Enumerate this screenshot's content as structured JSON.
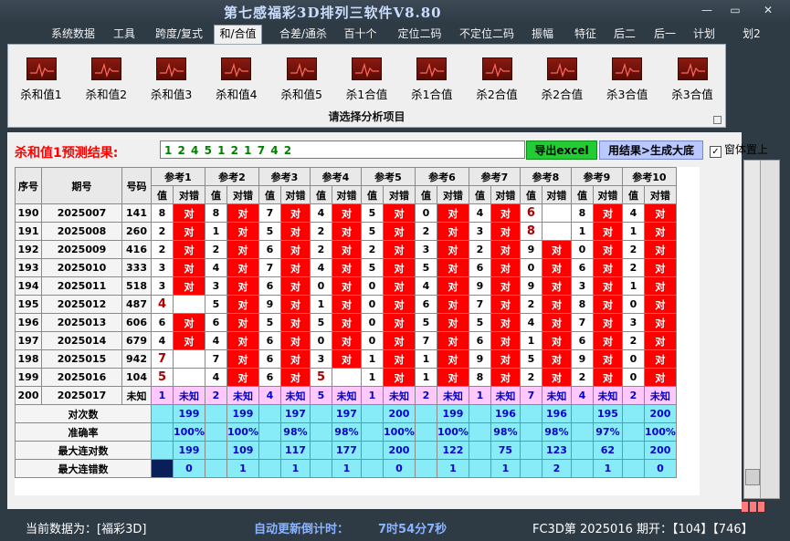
{
  "app": {
    "title": "第七感福彩3D排列三软件V8.80"
  },
  "window_buttons": {
    "minimize": "—",
    "restore": "▭",
    "close": "✕"
  },
  "menu": {
    "items": [
      "系统数据",
      "工具",
      "跨度/复式",
      "和/合值",
      "合差/通杀",
      "百十个",
      "定位二码",
      "不定位二码",
      "振幅",
      "特征",
      "后二",
      "后一",
      "计划",
      "划2"
    ],
    "active_index": 3
  },
  "ribbon": {
    "buttons": [
      "杀和值1",
      "杀和值2",
      "杀和值3",
      "杀和值4",
      "杀和值5",
      "杀1合值",
      "杀1合值",
      "杀2合值",
      "杀2合值",
      "杀3合值",
      "杀3合值"
    ],
    "caption": "请选择分析项目",
    "icon": "line-chart-icon"
  },
  "prediction": {
    "label": "杀和值1预测结果:",
    "value": "1 2 4 5 1 2 1 7 4 2",
    "export_button": "导出excel",
    "generate_button": "用结果>生成大底",
    "topmost_label": "窗体置上",
    "topmost_checked": "✓"
  },
  "table": {
    "headers": {
      "seq": "序号",
      "period": "期号",
      "number": "号码",
      "value": "值",
      "result": "对错"
    },
    "groups": [
      "参考1",
      "参考2",
      "参考3",
      "参考4",
      "参考5",
      "参考6",
      "参考7",
      "参考8",
      "参考9",
      "参考10"
    ],
    "hit_text": "对",
    "rows": [
      {
        "seq": "190",
        "period": "2025007",
        "number": "141",
        "values": [
          "8",
          "8",
          "7",
          "4",
          "5",
          "0",
          "4",
          "6",
          "8",
          "4"
        ],
        "hits": [
          1,
          1,
          1,
          1,
          1,
          1,
          1,
          0,
          1,
          1
        ]
      },
      {
        "seq": "191",
        "period": "2025008",
        "number": "260",
        "values": [
          "2",
          "1",
          "5",
          "2",
          "5",
          "2",
          "3",
          "8",
          "1",
          "1"
        ],
        "hits": [
          1,
          1,
          1,
          1,
          1,
          1,
          1,
          0,
          1,
          1
        ]
      },
      {
        "seq": "192",
        "period": "2025009",
        "number": "416",
        "values": [
          "2",
          "2",
          "6",
          "2",
          "2",
          "3",
          "2",
          "9",
          "0",
          "2"
        ],
        "hits": [
          1,
          1,
          1,
          1,
          1,
          1,
          1,
          1,
          1,
          1
        ]
      },
      {
        "seq": "193",
        "period": "2025010",
        "number": "333",
        "values": [
          "3",
          "4",
          "7",
          "4",
          "5",
          "5",
          "6",
          "0",
          "6",
          "2"
        ],
        "hits": [
          1,
          1,
          1,
          1,
          1,
          1,
          1,
          1,
          1,
          1
        ]
      },
      {
        "seq": "194",
        "period": "2025011",
        "number": "518",
        "values": [
          "3",
          "3",
          "6",
          "0",
          "0",
          "4",
          "9",
          "9",
          "3",
          "1"
        ],
        "hits": [
          1,
          1,
          1,
          1,
          1,
          1,
          1,
          1,
          1,
          1
        ]
      },
      {
        "seq": "195",
        "period": "2025012",
        "number": "487",
        "values": [
          "4",
          "5",
          "9",
          "1",
          "0",
          "6",
          "7",
          "2",
          "8",
          "0"
        ],
        "hits": [
          0,
          1,
          1,
          1,
          1,
          1,
          1,
          1,
          1,
          1
        ]
      },
      {
        "seq": "196",
        "period": "2025013",
        "number": "606",
        "values": [
          "6",
          "6",
          "5",
          "5",
          "0",
          "5",
          "5",
          "4",
          "7",
          "3"
        ],
        "hits": [
          1,
          1,
          1,
          1,
          1,
          1,
          1,
          1,
          1,
          1
        ]
      },
      {
        "seq": "197",
        "period": "2025014",
        "number": "679",
        "values": [
          "4",
          "4",
          "6",
          "0",
          "0",
          "7",
          "6",
          "1",
          "6",
          "2"
        ],
        "hits": [
          1,
          1,
          1,
          1,
          1,
          1,
          1,
          1,
          1,
          1
        ]
      },
      {
        "seq": "198",
        "period": "2025015",
        "number": "942",
        "values": [
          "7",
          "7",
          "6",
          "3",
          "1",
          "1",
          "9",
          "5",
          "9",
          "0"
        ],
        "hits": [
          0,
          1,
          1,
          1,
          1,
          1,
          1,
          1,
          1,
          1
        ]
      },
      {
        "seq": "199",
        "period": "2025016",
        "number": "104",
        "values": [
          "5",
          "4",
          "6",
          "5",
          "1",
          "1",
          "8",
          "2",
          "2",
          "0"
        ],
        "hits": [
          0,
          1,
          1,
          0,
          1,
          1,
          1,
          1,
          1,
          1
        ]
      }
    ],
    "missed_values": [
      [
        7
      ],
      [
        7
      ],
      [],
      [],
      [],
      [],
      [],
      [],
      [
        0
      ],
      [
        0,
        3
      ]
    ],
    "prediction_row": {
      "seq": "200",
      "period": "2025017",
      "number": "未知",
      "values": [
        "1",
        "2",
        "4",
        "5",
        "1",
        "2",
        "1",
        "7",
        "4",
        "2"
      ],
      "unknown_text": "未知"
    },
    "stats": [
      {
        "label": "对次数",
        "values": [
          "199",
          "199",
          "197",
          "197",
          "200",
          "199",
          "196",
          "196",
          "195",
          "200"
        ]
      },
      {
        "label": "准确率",
        "values": [
          "100%",
          "100%",
          "98%",
          "98%",
          "100%",
          "100%",
          "98%",
          "98%",
          "97%",
          "100%"
        ]
      },
      {
        "label": "最大连对数",
        "values": [
          "199",
          "109",
          "117",
          "177",
          "200",
          "122",
          "75",
          "123",
          "62",
          "200"
        ]
      },
      {
        "label": "最大连错数",
        "values": [
          "0",
          "1",
          "1",
          "1",
          "0",
          "1",
          "1",
          "2",
          "1",
          "0"
        ]
      }
    ]
  },
  "status": {
    "current_data": "当前数据为：[福彩3D]",
    "countdown_label": "自动更新倒计时：",
    "countdown_value": "7时54分7秒",
    "period_info": "FC3D第 2025016 期开：【104】【746】"
  },
  "colors": {
    "hit": "#ff0000",
    "prediction_row": "#ffc8ff",
    "stats": "#88ecf8",
    "predict_text": "#008000",
    "label_red": "#ff0000"
  }
}
